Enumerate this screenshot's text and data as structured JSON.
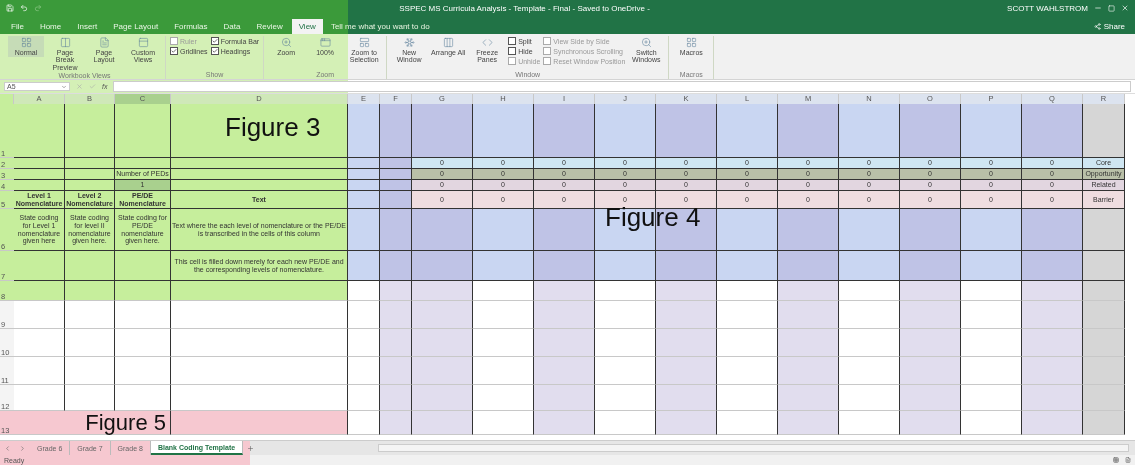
{
  "window": {
    "title": "SSPEC MS Curricula Analysis - Template - Final - Saved to OneDrive -",
    "user": "SCOTT WAHLSTROM"
  },
  "ribbon_tabs": [
    {
      "label": "File",
      "selected": false
    },
    {
      "label": "Home",
      "selected": false
    },
    {
      "label": "Insert",
      "selected": false
    },
    {
      "label": "Page Layout",
      "selected": false
    },
    {
      "label": "Formulas",
      "selected": false
    },
    {
      "label": "Data",
      "selected": false
    },
    {
      "label": "Review",
      "selected": false
    },
    {
      "label": "View",
      "selected": true
    }
  ],
  "tell_me": "Tell me what you want to do",
  "share": "Share",
  "ribbon_groups": [
    {
      "name": "Workbook Views",
      "items": [
        {
          "kind": "large",
          "label": "Normal",
          "selected": true
        },
        {
          "kind": "large",
          "label": "Page Break Preview",
          "selected": false
        },
        {
          "kind": "large",
          "label": "Page Layout",
          "selected": false
        },
        {
          "kind": "large",
          "label": "Custom Views",
          "selected": false
        }
      ]
    },
    {
      "name": "Show",
      "items": [
        {
          "kind": "check",
          "label": "Ruler",
          "checked": false,
          "disabled": true
        },
        {
          "kind": "check",
          "label": "Gridlines",
          "checked": true,
          "disabled": false
        },
        {
          "kind": "check",
          "label": "Formula Bar",
          "checked": true,
          "disabled": false
        },
        {
          "kind": "check",
          "label": "Headings",
          "checked": true,
          "disabled": false
        }
      ]
    },
    {
      "name": "Zoom",
      "items": [
        {
          "kind": "large",
          "label": "Zoom",
          "selected": false
        },
        {
          "kind": "large",
          "label": "100%",
          "selected": false
        },
        {
          "kind": "large",
          "label": "Zoom to Selection",
          "selected": false
        }
      ]
    },
    {
      "name": "Window",
      "items": [
        {
          "kind": "large",
          "label": "New Window",
          "selected": false
        },
        {
          "kind": "large",
          "label": "Arrange All",
          "selected": false
        },
        {
          "kind": "large",
          "label": "Freeze Panes",
          "selected": false
        },
        {
          "kind": "small",
          "label": "Split",
          "disabled": false
        },
        {
          "kind": "small",
          "label": "Hide",
          "disabled": false
        },
        {
          "kind": "small",
          "label": "Unhide",
          "disabled": true
        },
        {
          "kind": "small",
          "label": "View Side by Side",
          "disabled": true
        },
        {
          "kind": "small",
          "label": "Synchronous Scrolling",
          "disabled": true
        },
        {
          "kind": "small",
          "label": "Reset Window Position",
          "disabled": true
        },
        {
          "kind": "large",
          "label": "Switch Windows",
          "selected": false
        }
      ]
    },
    {
      "name": "Macros",
      "items": [
        {
          "kind": "large",
          "label": "Macros",
          "selected": false
        }
      ]
    }
  ],
  "formula_bar": {
    "name_box": "A5",
    "function_label": "fx"
  },
  "columns": [
    "A",
    "B",
    "C",
    "D",
    "E",
    "F",
    "G",
    "H",
    "I",
    "J",
    "K",
    "L",
    "M",
    "N",
    "O",
    "P",
    "Q",
    "R"
  ],
  "rows": [
    {
      "number": "1",
      "cells": {}
    },
    {
      "number": "2",
      "color": "#cfe6f2",
      "cells": {
        "G": "0",
        "H": "0",
        "I": "0",
        "J": "0",
        "K": "0",
        "L": "0",
        "M": "0",
        "N": "0",
        "O": "0",
        "P": "0",
        "Q": "0",
        "R": "Core"
      }
    },
    {
      "number": "3",
      "color": "#b9c0a8",
      "cells": {
        "C": "Number of PEDs",
        "G": "0",
        "H": "0",
        "I": "0",
        "J": "0",
        "K": "0",
        "L": "0",
        "M": "0",
        "N": "0",
        "O": "0",
        "P": "0",
        "Q": "0",
        "R": "Opportunity"
      }
    },
    {
      "number": "4",
      "color": "#e2d6e0",
      "cells": {
        "C": "1",
        "G": "0",
        "H": "0",
        "I": "0",
        "J": "0",
        "K": "0",
        "L": "0",
        "M": "0",
        "N": "0",
        "O": "0",
        "P": "0",
        "Q": "0",
        "R": "Related"
      }
    },
    {
      "number": "5",
      "color": "#efdde0",
      "cells": {
        "A": "Level 1 Nomenclature",
        "B": "Level 2 Nomenclature",
        "C": "PE/DE Nomenclature",
        "D": "Text",
        "G": "0",
        "H": "0",
        "I": "0",
        "J": "0",
        "K": "0",
        "L": "0",
        "M": "0",
        "N": "0",
        "O": "0",
        "P": "0",
        "Q": "0",
        "R": "Barrier"
      }
    },
    {
      "number": "6",
      "cells": {
        "A": "State coding for Level 1 nomenclature given here",
        "B": "State coding for level II nomenclature given here.",
        "C": "State coding for PE/DE nomenclature given here.",
        "D": "Text where the each level of nomenclature or the PE/DE is transcribed in the cells of this column"
      }
    },
    {
      "number": "7",
      "cells": {
        "D": "This cell is filled down merely for each new PE/DE and the corresponding levels of nomenclature."
      }
    },
    {
      "number": "8",
      "cells": {}
    },
    {
      "number": "9",
      "cells": {}
    },
    {
      "number": "10",
      "cells": {}
    },
    {
      "number": "11",
      "cells": {}
    },
    {
      "number": "12",
      "cells": {}
    },
    {
      "number": "13",
      "cells": {}
    }
  ],
  "figures": [
    {
      "label": "Figure 3",
      "color": "#c6ee9c"
    },
    {
      "label": "Figure 4",
      "color": "#c9d6f2"
    },
    {
      "label": "Figure 5",
      "color": "#f6c8d0"
    }
  ],
  "sheet_tabs": [
    {
      "label": "Grade 6",
      "selected": false
    },
    {
      "label": "Grade 7",
      "selected": false
    },
    {
      "label": "Grade 8",
      "selected": false
    },
    {
      "label": "Blank Coding Template",
      "selected": true
    }
  ],
  "status": "Ready"
}
